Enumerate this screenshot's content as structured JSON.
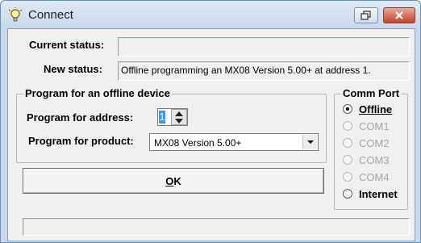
{
  "window": {
    "title": "Connect"
  },
  "status": {
    "current_label": "Current status:",
    "current_value": "",
    "new_label": "New status:",
    "new_value": "Offline programming an MX08 Version 5.00+ at address 1."
  },
  "offline_group": {
    "legend": "Program for an offline device",
    "address_label": "Program for address:",
    "address_value": "1",
    "product_label": "Program for product:",
    "product_value": "MX08 Version 5.00+"
  },
  "ok_button": {
    "accel": "O",
    "rest": "K"
  },
  "comm_port": {
    "legend": "Comm Port",
    "options": [
      {
        "label": "Offline",
        "checked": true,
        "enabled": true
      },
      {
        "label": "COM1",
        "checked": false,
        "enabled": false
      },
      {
        "label": "COM2",
        "checked": false,
        "enabled": false
      },
      {
        "label": "COM3",
        "checked": false,
        "enabled": false
      },
      {
        "label": "COM4",
        "checked": false,
        "enabled": false
      },
      {
        "label": "Internet",
        "checked": false,
        "enabled": true
      }
    ]
  },
  "status_bar": {
    "text": ""
  },
  "colors": {
    "selection": "#3399ff",
    "close_button": "#c4432e"
  },
  "icons": [
    "bulb-icon",
    "restore-icon",
    "close-icon",
    "spin-up-icon",
    "spin-down-icon",
    "dropdown-arrow-icon"
  ]
}
